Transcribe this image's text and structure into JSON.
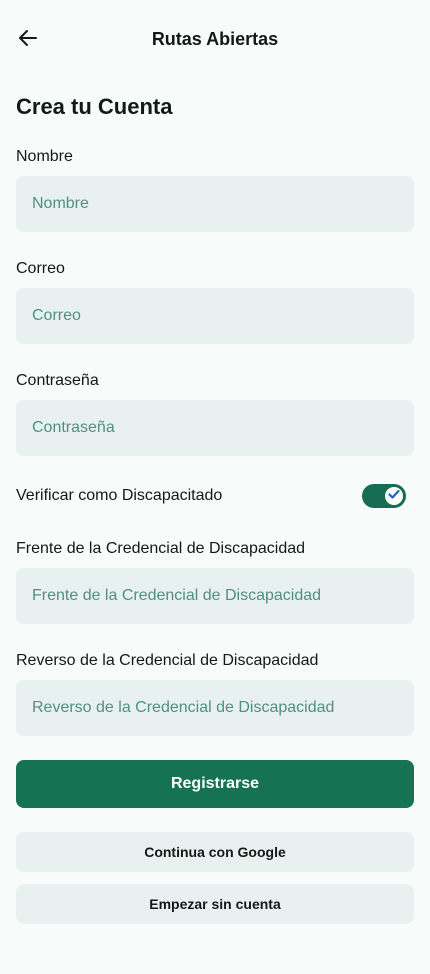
{
  "header": {
    "back_icon": "arrow-left-icon",
    "title": "Rutas Abiertas"
  },
  "heading": "Crea tu Cuenta",
  "form": {
    "name": {
      "label": "Nombre",
      "placeholder": "Nombre",
      "value": ""
    },
    "email": {
      "label": "Correo",
      "placeholder": "Correo",
      "value": ""
    },
    "password": {
      "label": "Contraseña",
      "placeholder": "Contraseña",
      "value": ""
    },
    "verify_disabled": {
      "label": "Verificar como Discapacitado",
      "checked": true
    },
    "credential_front": {
      "label": "Frente de la Credencial de Discapacidad",
      "placeholder": "Frente de la Credencial de Discapacidad",
      "value": ""
    },
    "credential_back": {
      "label": "Reverso de la Credencial de Discapacidad",
      "placeholder": "Reverso de la Credencial de Discapacidad",
      "value": ""
    }
  },
  "buttons": {
    "register": "Registrarse",
    "google": "Continua con Google",
    "guest": "Empezar sin cuenta"
  },
  "colors": {
    "background": "#f7fbfa",
    "field_bg": "#e8f1ef",
    "placeholder": "#4f917c",
    "primary": "#157252",
    "text": "#121a17"
  }
}
